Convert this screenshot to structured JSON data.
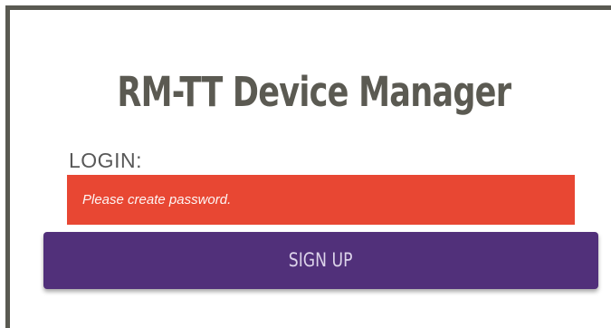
{
  "app": {
    "title": "RM-TT Device Manager"
  },
  "login_form": {
    "label": "LOGIN:",
    "password_placeholder": "Please create password.",
    "signup_label": "SIGN UP"
  },
  "colors": {
    "title_text": "#5b5a52",
    "error_field_bg": "#e84733",
    "button_bg": "#51307a",
    "frame_border": "#5a5a52"
  }
}
